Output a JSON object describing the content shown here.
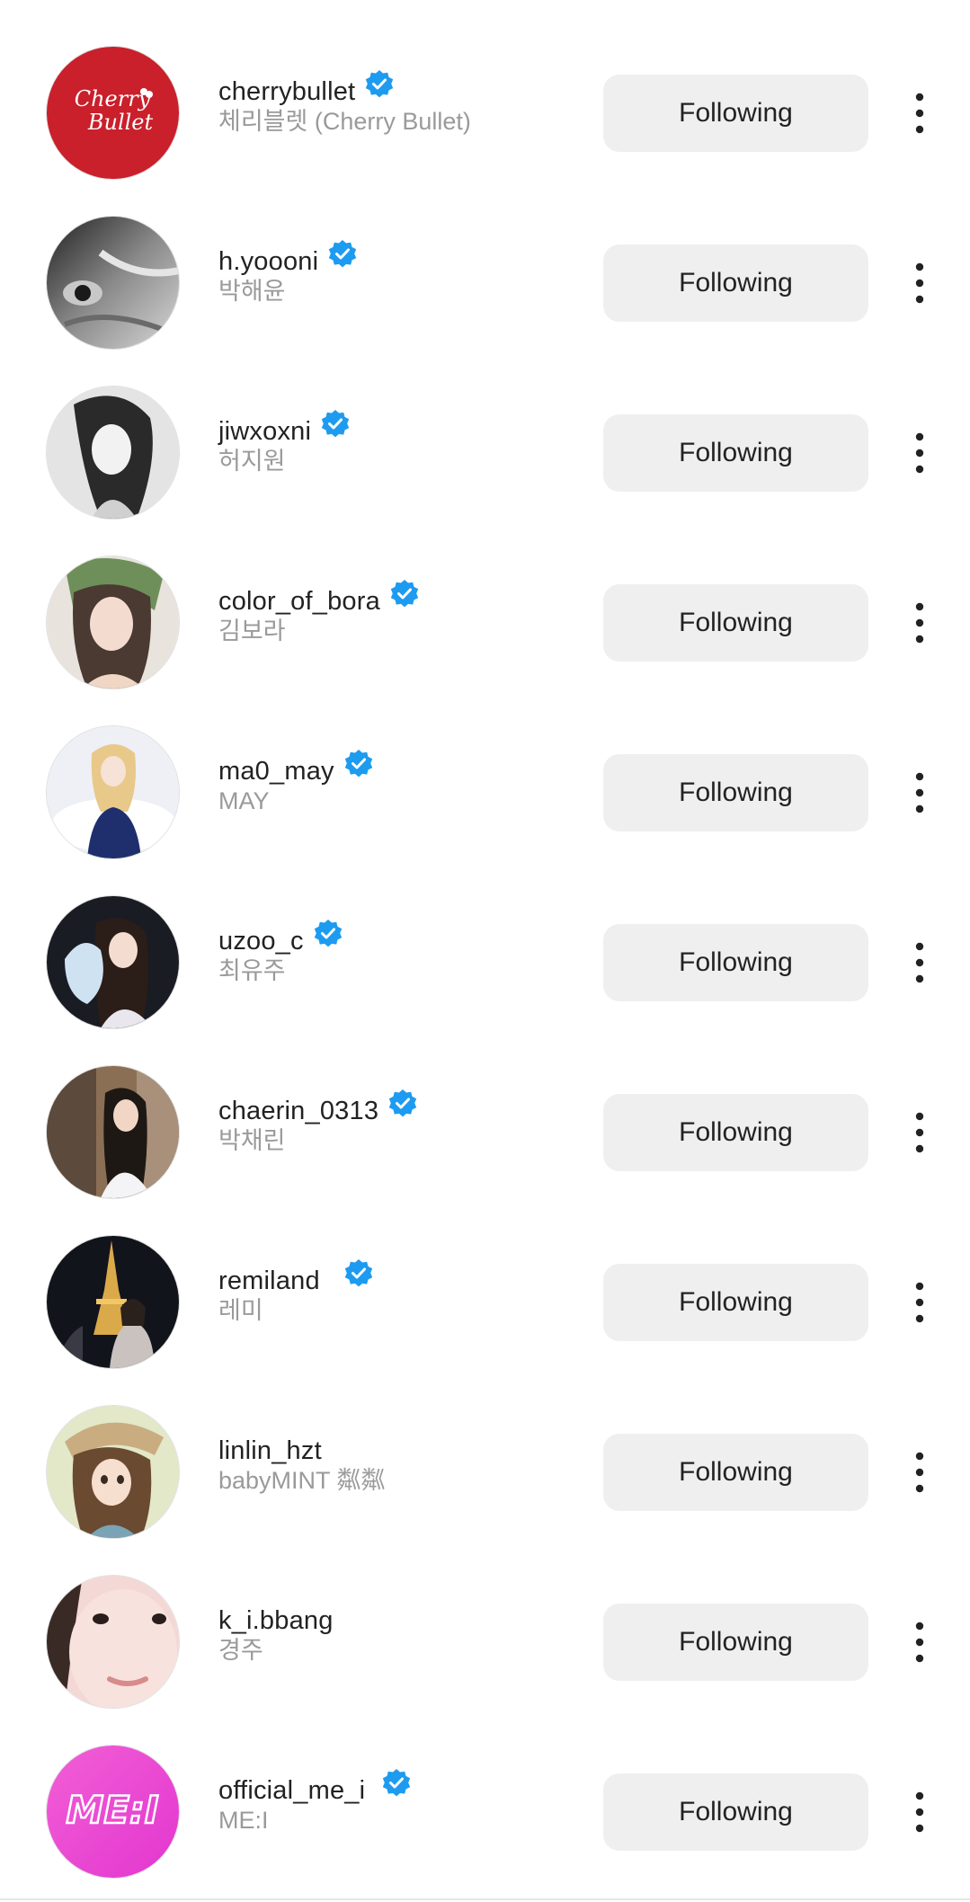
{
  "accounts": [
    {
      "username": "cherrybullet",
      "full_name": "체리블렛 (Cherry Bullet)",
      "verified": true,
      "button": "Following",
      "avatar_text": "Cherry Bullet",
      "avatar_color": "#c9202b"
    },
    {
      "username": "h.yoooni",
      "full_name": "박해윤",
      "verified": true,
      "button": "Following"
    },
    {
      "username": "jiwxoxni",
      "full_name": "허지원",
      "verified": true,
      "button": "Following"
    },
    {
      "username": "color_of_bora",
      "full_name": "김보라",
      "verified": true,
      "button": "Following"
    },
    {
      "username": "ma0_may",
      "full_name": "MAY",
      "verified": true,
      "button": "Following"
    },
    {
      "username": "uzoo_c",
      "full_name": "최유주",
      "verified": true,
      "button": "Following"
    },
    {
      "username": "chaerin_0313",
      "full_name": "박채린",
      "verified": true,
      "button": "Following"
    },
    {
      "username": "remiland",
      "full_name": "레미",
      "verified": true,
      "button": "Following"
    },
    {
      "username": "linlin_hzt",
      "full_name": "babyMINT 粼粼",
      "verified": false,
      "button": "Following"
    },
    {
      "username": "k_i.bbang",
      "full_name": "경주",
      "verified": false,
      "button": "Following"
    },
    {
      "username": "official_me_i",
      "full_name": "ME:I",
      "verified": true,
      "button": "Following",
      "avatar_text": "ME:I",
      "avatar_color": "#e040d8"
    }
  ],
  "colors": {
    "verified_blue": "#1d9bf0",
    "button_bg": "#efefef",
    "text_primary": "#222222",
    "text_secondary": "#9a9a9a"
  },
  "icons": {
    "verified": "verified-badge-icon",
    "more": "more-options-icon"
  }
}
